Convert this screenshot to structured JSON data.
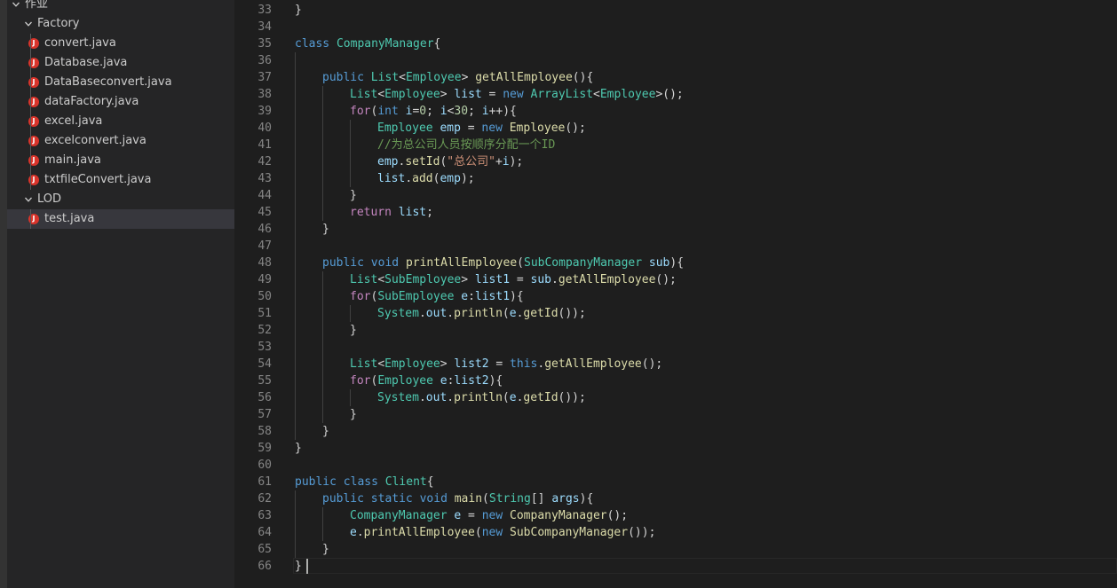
{
  "explorer": {
    "root": {
      "label": "作业",
      "expanded": true
    },
    "folders": [
      {
        "label": "Factory",
        "expanded": true,
        "files": [
          "convert.java",
          "Database.java",
          "DataBaseconvert.java",
          "dataFactory.java",
          "excel.java",
          "excelconvert.java",
          "main.java",
          "txtfileConvert.java"
        ]
      },
      {
        "label": "LOD",
        "expanded": true,
        "files": [
          "test.java"
        ]
      }
    ],
    "selected_file": "test.java",
    "file_icon_letter": "J",
    "file_icon_color": "#d9342b"
  },
  "editor": {
    "current_line": 66,
    "lines": [
      {
        "n": "33",
        "indent": 0,
        "tokens": [
          [
            "p",
            "}"
          ]
        ]
      },
      {
        "n": "34",
        "indent": 0,
        "tokens": []
      },
      {
        "n": "35",
        "indent": 0,
        "tokens": [
          [
            "kw",
            "class"
          ],
          [
            "p",
            " "
          ],
          [
            "ty",
            "CompanyManager"
          ],
          [
            "p",
            "{"
          ]
        ]
      },
      {
        "n": "36",
        "indent": 0,
        "tokens": []
      },
      {
        "n": "37",
        "indent": 1,
        "tokens": [
          [
            "kw",
            "public"
          ],
          [
            "p",
            " "
          ],
          [
            "ty",
            "List"
          ],
          [
            "p",
            "<"
          ],
          [
            "ty",
            "Employee"
          ],
          [
            "p",
            "> "
          ],
          [
            "fn",
            "getAllEmployee"
          ],
          [
            "p",
            "(){"
          ]
        ]
      },
      {
        "n": "38",
        "indent": 2,
        "tokens": [
          [
            "ty",
            "List"
          ],
          [
            "p",
            "<"
          ],
          [
            "ty",
            "Employee"
          ],
          [
            "p",
            "> "
          ],
          [
            "var",
            "list"
          ],
          [
            "p",
            " = "
          ],
          [
            "kw",
            "new"
          ],
          [
            "p",
            " "
          ],
          [
            "ty",
            "ArrayList"
          ],
          [
            "p",
            "<"
          ],
          [
            "ty",
            "Employee"
          ],
          [
            "p",
            ">();"
          ]
        ]
      },
      {
        "n": "39",
        "indent": 2,
        "tokens": [
          [
            "ctl",
            "for"
          ],
          [
            "p",
            "("
          ],
          [
            "kw",
            "int"
          ],
          [
            "p",
            " "
          ],
          [
            "var",
            "i"
          ],
          [
            "p",
            "="
          ],
          [
            "num",
            "0"
          ],
          [
            "p",
            "; "
          ],
          [
            "var",
            "i"
          ],
          [
            "p",
            "<"
          ],
          [
            "num",
            "30"
          ],
          [
            "p",
            "; "
          ],
          [
            "var",
            "i"
          ],
          [
            "p",
            "++){"
          ]
        ]
      },
      {
        "n": "40",
        "indent": 3,
        "tokens": [
          [
            "ty",
            "Employee"
          ],
          [
            "p",
            " "
          ],
          [
            "var",
            "emp"
          ],
          [
            "p",
            " = "
          ],
          [
            "kw",
            "new"
          ],
          [
            "p",
            " "
          ],
          [
            "fn",
            "Employee"
          ],
          [
            "p",
            "();"
          ]
        ]
      },
      {
        "n": "41",
        "indent": 3,
        "tokens": [
          [
            "cmt",
            "//为总公司人员按顺序分配一个ID"
          ]
        ]
      },
      {
        "n": "42",
        "indent": 3,
        "tokens": [
          [
            "var",
            "emp"
          ],
          [
            "p",
            "."
          ],
          [
            "fn",
            "setId"
          ],
          [
            "p",
            "("
          ],
          [
            "str",
            "\"总公司\""
          ],
          [
            "p",
            "+"
          ],
          [
            "var",
            "i"
          ],
          [
            "p",
            ");"
          ]
        ]
      },
      {
        "n": "43",
        "indent": 3,
        "tokens": [
          [
            "var",
            "list"
          ],
          [
            "p",
            "."
          ],
          [
            "fn",
            "add"
          ],
          [
            "p",
            "("
          ],
          [
            "var",
            "emp"
          ],
          [
            "p",
            ");"
          ]
        ]
      },
      {
        "n": "44",
        "indent": 2,
        "tokens": [
          [
            "p",
            "}"
          ]
        ]
      },
      {
        "n": "45",
        "indent": 2,
        "tokens": [
          [
            "ctl",
            "return"
          ],
          [
            "p",
            " "
          ],
          [
            "var",
            "list"
          ],
          [
            "p",
            ";"
          ]
        ]
      },
      {
        "n": "46",
        "indent": 1,
        "tokens": [
          [
            "p",
            "}"
          ]
        ]
      },
      {
        "n": "47",
        "indent": 0,
        "tokens": []
      },
      {
        "n": "48",
        "indent": 1,
        "tokens": [
          [
            "kw",
            "public"
          ],
          [
            "p",
            " "
          ],
          [
            "kw",
            "void"
          ],
          [
            "p",
            " "
          ],
          [
            "fn",
            "printAllEmployee"
          ],
          [
            "p",
            "("
          ],
          [
            "ty",
            "SubCompanyManager"
          ],
          [
            "p",
            " "
          ],
          [
            "var",
            "sub"
          ],
          [
            "p",
            "){"
          ]
        ]
      },
      {
        "n": "49",
        "indent": 2,
        "tokens": [
          [
            "ty",
            "List"
          ],
          [
            "p",
            "<"
          ],
          [
            "ty",
            "SubEmployee"
          ],
          [
            "p",
            "> "
          ],
          [
            "var",
            "list1"
          ],
          [
            "p",
            " = "
          ],
          [
            "var",
            "sub"
          ],
          [
            "p",
            "."
          ],
          [
            "fn",
            "getAllEmployee"
          ],
          [
            "p",
            "();"
          ]
        ]
      },
      {
        "n": "50",
        "indent": 2,
        "tokens": [
          [
            "ctl",
            "for"
          ],
          [
            "p",
            "("
          ],
          [
            "ty",
            "SubEmployee"
          ],
          [
            "p",
            " "
          ],
          [
            "var",
            "e"
          ],
          [
            "p",
            ":"
          ],
          [
            "var",
            "list1"
          ],
          [
            "p",
            "){"
          ]
        ]
      },
      {
        "n": "51",
        "indent": 3,
        "tokens": [
          [
            "ty",
            "System"
          ],
          [
            "p",
            "."
          ],
          [
            "var",
            "out"
          ],
          [
            "p",
            "."
          ],
          [
            "fn",
            "println"
          ],
          [
            "p",
            "("
          ],
          [
            "var",
            "e"
          ],
          [
            "p",
            "."
          ],
          [
            "fn",
            "getId"
          ],
          [
            "p",
            "());"
          ]
        ]
      },
      {
        "n": "52",
        "indent": 2,
        "tokens": [
          [
            "p",
            "}"
          ]
        ]
      },
      {
        "n": "53",
        "indent": 0,
        "tokens": []
      },
      {
        "n": "54",
        "indent": 2,
        "tokens": [
          [
            "ty",
            "List"
          ],
          [
            "p",
            "<"
          ],
          [
            "ty",
            "Employee"
          ],
          [
            "p",
            "> "
          ],
          [
            "var",
            "list2"
          ],
          [
            "p",
            " = "
          ],
          [
            "kw",
            "this"
          ],
          [
            "p",
            "."
          ],
          [
            "fn",
            "getAllEmployee"
          ],
          [
            "p",
            "();"
          ]
        ]
      },
      {
        "n": "55",
        "indent": 2,
        "tokens": [
          [
            "ctl",
            "for"
          ],
          [
            "p",
            "("
          ],
          [
            "ty",
            "Employee"
          ],
          [
            "p",
            " "
          ],
          [
            "var",
            "e"
          ],
          [
            "p",
            ":"
          ],
          [
            "var",
            "list2"
          ],
          [
            "p",
            "){"
          ]
        ]
      },
      {
        "n": "56",
        "indent": 3,
        "tokens": [
          [
            "ty",
            "System"
          ],
          [
            "p",
            "."
          ],
          [
            "var",
            "out"
          ],
          [
            "p",
            "."
          ],
          [
            "fn",
            "println"
          ],
          [
            "p",
            "("
          ],
          [
            "var",
            "e"
          ],
          [
            "p",
            "."
          ],
          [
            "fn",
            "getId"
          ],
          [
            "p",
            "());"
          ]
        ]
      },
      {
        "n": "57",
        "indent": 2,
        "tokens": [
          [
            "p",
            "}"
          ]
        ]
      },
      {
        "n": "58",
        "indent": 1,
        "tokens": [
          [
            "p",
            "}"
          ]
        ]
      },
      {
        "n": "59",
        "indent": 0,
        "tokens": [
          [
            "p",
            "}"
          ]
        ]
      },
      {
        "n": "60",
        "indent": 0,
        "tokens": []
      },
      {
        "n": "61",
        "indent": 0,
        "tokens": [
          [
            "kw",
            "public"
          ],
          [
            "p",
            " "
          ],
          [
            "kw",
            "class"
          ],
          [
            "p",
            " "
          ],
          [
            "ty",
            "Client"
          ],
          [
            "p",
            "{"
          ]
        ]
      },
      {
        "n": "62",
        "indent": 1,
        "tokens": [
          [
            "kw",
            "public"
          ],
          [
            "p",
            " "
          ],
          [
            "kw",
            "static"
          ],
          [
            "p",
            " "
          ],
          [
            "kw",
            "void"
          ],
          [
            "p",
            " "
          ],
          [
            "fn",
            "main"
          ],
          [
            "p",
            "("
          ],
          [
            "ty",
            "String"
          ],
          [
            "p",
            "[] "
          ],
          [
            "var",
            "args"
          ],
          [
            "p",
            "){"
          ]
        ]
      },
      {
        "n": "63",
        "indent": 2,
        "tokens": [
          [
            "ty",
            "CompanyManager"
          ],
          [
            "p",
            " "
          ],
          [
            "var",
            "e"
          ],
          [
            "p",
            " = "
          ],
          [
            "kw",
            "new"
          ],
          [
            "p",
            " "
          ],
          [
            "fn",
            "CompanyManager"
          ],
          [
            "p",
            "();"
          ]
        ]
      },
      {
        "n": "64",
        "indent": 2,
        "tokens": [
          [
            "var",
            "e"
          ],
          [
            "p",
            "."
          ],
          [
            "fn",
            "printAllEmployee"
          ],
          [
            "p",
            "("
          ],
          [
            "kw",
            "new"
          ],
          [
            "p",
            " "
          ],
          [
            "fn",
            "SubCompanyManager"
          ],
          [
            "p",
            "());"
          ]
        ]
      },
      {
        "n": "65",
        "indent": 1,
        "tokens": [
          [
            "p",
            "}"
          ]
        ]
      },
      {
        "n": "66",
        "indent": 0,
        "tokens": [
          [
            "p",
            "}"
          ]
        ]
      }
    ]
  }
}
